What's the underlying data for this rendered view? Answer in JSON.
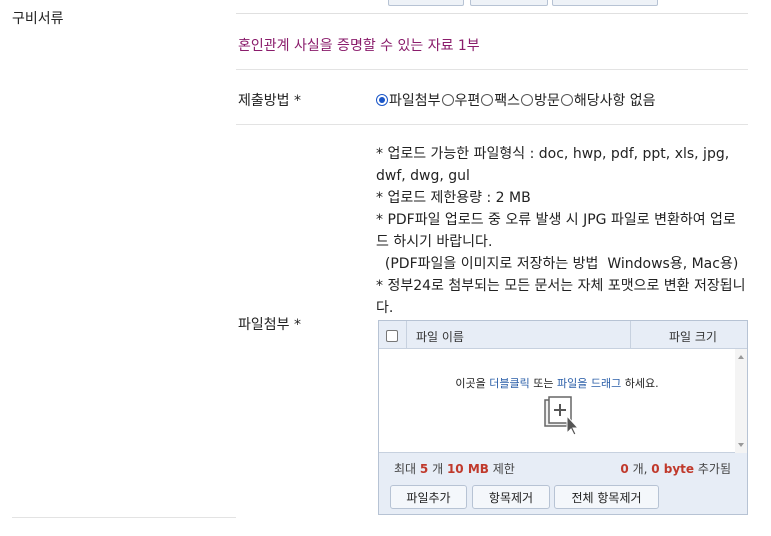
{
  "section_label": "구비서류",
  "doc_description": "혼인관계 사실을 증명할 수 있는 자료 1부",
  "submit_method": {
    "label": "제출방법 *",
    "options": [
      "파일첨부",
      "우편",
      "팩스",
      "방문",
      "해당사항 없음"
    ],
    "selected": "파일첨부"
  },
  "attach": {
    "label": "파일첨부 *",
    "notes": [
      "* 업로드 가능한 파일형식 : doc, hwp, pdf, ppt, xls, jpg, dwf, dwg, gul",
      "* 업로드 제한용량 : 2 MB",
      "* PDF파일 업로드 중 오류 발생 시 JPG 파일로 변환하여 업로드 하시기 바랍니다.",
      "  (PDF파일을 이미지로 저장하는 방법  Windows용, Mac용)",
      "* 정부24로 첨부되는 모든 문서는 자체 포맷으로 변환 저장됩니다."
    ]
  },
  "uploader": {
    "col_name": "파일 이름",
    "col_size": "파일 크기",
    "hint_prefix": "이곳을 ",
    "hint_dblclick": "더블클릭",
    "hint_middle": " 또는 ",
    "hint_drag": "파일을 드래그",
    "hint_suffix": " 하세요.",
    "limit_prefix": "최대 ",
    "limit_count": "5",
    "limit_count_unit": " 개 ",
    "limit_size": "10 MB",
    "limit_suffix": " 제한",
    "added_count": "0",
    "added_count_unit": " 개, ",
    "added_size": "0 byte",
    "added_suffix": " 추가됨",
    "buttons": {
      "add": "파일추가",
      "remove": "항목제거",
      "remove_all": "전체 항목제거"
    }
  },
  "colors": {
    "description": "#8a1c6b",
    "accent_blue": "#2a5ea8",
    "status_red": "#c0392b",
    "uploader_bg": "#e7edf6"
  }
}
